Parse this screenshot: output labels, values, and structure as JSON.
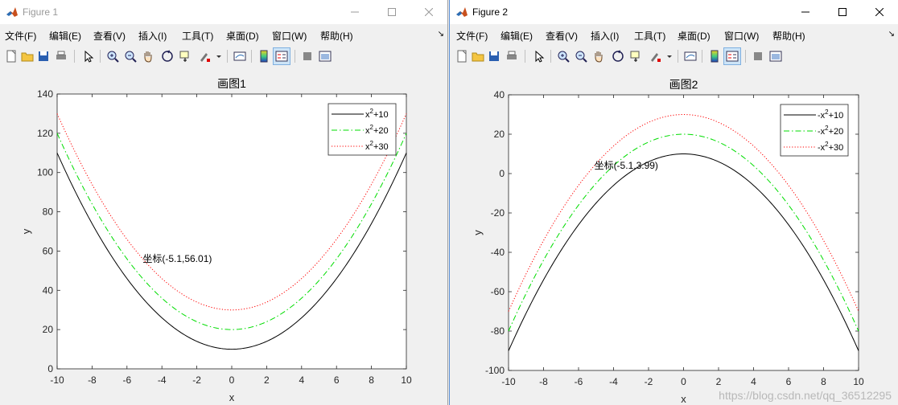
{
  "windows": [
    {
      "title": "Figure 1",
      "menu": [
        "文件(F)",
        "编辑(E)",
        "查看(V)",
        "插入(I)",
        "工具(T)",
        "桌面(D)",
        "窗口(W)",
        "帮助(H)"
      ],
      "menu_overflow": "↘",
      "chart_data": {
        "type": "line",
        "title": "画图1",
        "xlabel": "x",
        "ylabel": "y",
        "xlim": [
          -10,
          10
        ],
        "ylim": [
          0,
          140
        ],
        "xticks": [
          -10,
          -8,
          -6,
          -4,
          -2,
          0,
          2,
          4,
          6,
          8,
          10
        ],
        "yticks": [
          0,
          20,
          40,
          60,
          80,
          100,
          120,
          140
        ],
        "grid": false,
        "legend_position": "top-right",
        "series": [
          {
            "name_base": "x",
            "name_sup": "2",
            "name_tail": "+10",
            "sign": 1,
            "offset": 10,
            "color": "#000000",
            "dash": "solid"
          },
          {
            "name_base": "x",
            "name_sup": "2",
            "name_tail": "+20",
            "sign": 1,
            "offset": 20,
            "color": "#00dd00",
            "dash": "dashdot"
          },
          {
            "name_base": "x",
            "name_sup": "2",
            "name_tail": "+30",
            "sign": 1,
            "offset": 30,
            "color": "#ff0000",
            "dash": "dotted"
          }
        ],
        "annotation": {
          "text": "坐标(-5.1,56.01)",
          "x": -5.1,
          "y": 56.01
        }
      }
    },
    {
      "title": "Figure 2",
      "menu": [
        "文件(F)",
        "编辑(E)",
        "查看(V)",
        "插入(I)",
        "工具(T)",
        "桌面(D)",
        "窗口(W)",
        "帮助(H)"
      ],
      "menu_overflow": "↘",
      "chart_data": {
        "type": "line",
        "title": "画图2",
        "xlabel": "x",
        "ylabel": "y",
        "xlim": [
          -10,
          10
        ],
        "ylim": [
          -100,
          40
        ],
        "xticks": [
          -10,
          -8,
          -6,
          -4,
          -2,
          0,
          2,
          4,
          6,
          8,
          10
        ],
        "yticks": [
          -100,
          -80,
          -60,
          -40,
          -20,
          0,
          20,
          40
        ],
        "grid": false,
        "legend_position": "top-right",
        "series": [
          {
            "name_base": "-x",
            "name_sup": "2",
            "name_tail": "+10",
            "sign": -1,
            "offset": 10,
            "color": "#000000",
            "dash": "solid"
          },
          {
            "name_base": "-x",
            "name_sup": "2",
            "name_tail": "+20",
            "sign": -1,
            "offset": 20,
            "color": "#00dd00",
            "dash": "dashdot"
          },
          {
            "name_base": "-x",
            "name_sup": "2",
            "name_tail": "+30",
            "sign": -1,
            "offset": 30,
            "color": "#ff0000",
            "dash": "dotted"
          }
        ],
        "annotation": {
          "text": "坐标(-5.1,3.99)",
          "x": -5.1,
          "y": 3.99
        }
      }
    }
  ],
  "watermark": "https://blog.csdn.net/qq_36512295"
}
